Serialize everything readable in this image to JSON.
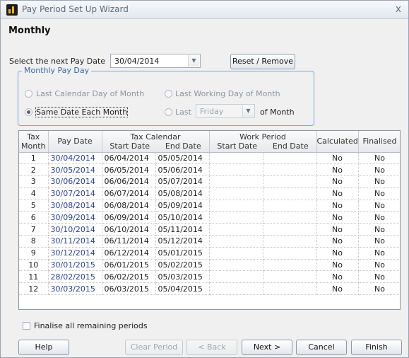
{
  "window": {
    "title": "Pay Period Set Up Wizard",
    "close_glyph": "x"
  },
  "heading": "Monthly",
  "pay_date": {
    "label": "Select the next Pay Date",
    "value": "30/04/2014"
  },
  "reset_button": "Reset / Remove",
  "pay_day_group": {
    "title": "Monthly Pay Day",
    "options": {
      "last_calendar": "Last Calendar Day of Month",
      "last_working": "Last Working Day of Month",
      "same_date": "Same Date Each Month",
      "last": "Last",
      "of_month": "of Month"
    },
    "weekday_value": "Friday",
    "selected": "same_date"
  },
  "grid": {
    "headers": {
      "tax_month": "Tax Month",
      "pay_date": "Pay Date",
      "tax_calendar": "Tax Calendar",
      "work_period": "Work Period",
      "start_date": "Start Date",
      "end_date": "End Date",
      "calculated": "Calculated",
      "finalised": "Finalised"
    },
    "rows": [
      {
        "month": "1",
        "pay": "30/04/2014",
        "start": "06/04/2014",
        "end": "05/05/2014",
        "wstart": "",
        "wend": "",
        "calc": "No",
        "fin": "No"
      },
      {
        "month": "2",
        "pay": "30/05/2014",
        "start": "06/05/2014",
        "end": "05/06/2014",
        "wstart": "",
        "wend": "",
        "calc": "No",
        "fin": "No"
      },
      {
        "month": "3",
        "pay": "30/06/2014",
        "start": "06/06/2014",
        "end": "05/07/2014",
        "wstart": "",
        "wend": "",
        "calc": "No",
        "fin": "No"
      },
      {
        "month": "4",
        "pay": "30/07/2014",
        "start": "06/07/2014",
        "end": "05/08/2014",
        "wstart": "",
        "wend": "",
        "calc": "No",
        "fin": "No"
      },
      {
        "month": "5",
        "pay": "30/08/2014",
        "start": "06/08/2014",
        "end": "05/09/2014",
        "wstart": "",
        "wend": "",
        "calc": "No",
        "fin": "No"
      },
      {
        "month": "6",
        "pay": "30/09/2014",
        "start": "06/09/2014",
        "end": "05/10/2014",
        "wstart": "",
        "wend": "",
        "calc": "No",
        "fin": "No"
      },
      {
        "month": "7",
        "pay": "30/10/2014",
        "start": "06/10/2014",
        "end": "05/11/2014",
        "wstart": "",
        "wend": "",
        "calc": "No",
        "fin": "No"
      },
      {
        "month": "8",
        "pay": "30/11/2014",
        "start": "06/11/2014",
        "end": "05/12/2014",
        "wstart": "",
        "wend": "",
        "calc": "No",
        "fin": "No"
      },
      {
        "month": "9",
        "pay": "30/12/2014",
        "start": "06/12/2014",
        "end": "05/01/2015",
        "wstart": "",
        "wend": "",
        "calc": "No",
        "fin": "No"
      },
      {
        "month": "10",
        "pay": "30/01/2015",
        "start": "06/01/2015",
        "end": "05/02/2015",
        "wstart": "",
        "wend": "",
        "calc": "No",
        "fin": "No"
      },
      {
        "month": "11",
        "pay": "28/02/2015",
        "start": "06/02/2015",
        "end": "05/03/2015",
        "wstart": "",
        "wend": "",
        "calc": "No",
        "fin": "No"
      },
      {
        "month": "12",
        "pay": "30/03/2015",
        "start": "06/03/2015",
        "end": "05/04/2015",
        "wstart": "",
        "wend": "",
        "calc": "No",
        "fin": "No"
      }
    ]
  },
  "finalise_checkbox": "Finalise all remaining periods",
  "buttons": {
    "help": "Help",
    "clear_period": "Clear Period",
    "back": "< Back",
    "next": "Next >",
    "cancel": "Cancel",
    "finish": "Finish"
  },
  "colors": {
    "pay_date_text": "#2a3f9a",
    "group_border": "#7aa7d6"
  }
}
